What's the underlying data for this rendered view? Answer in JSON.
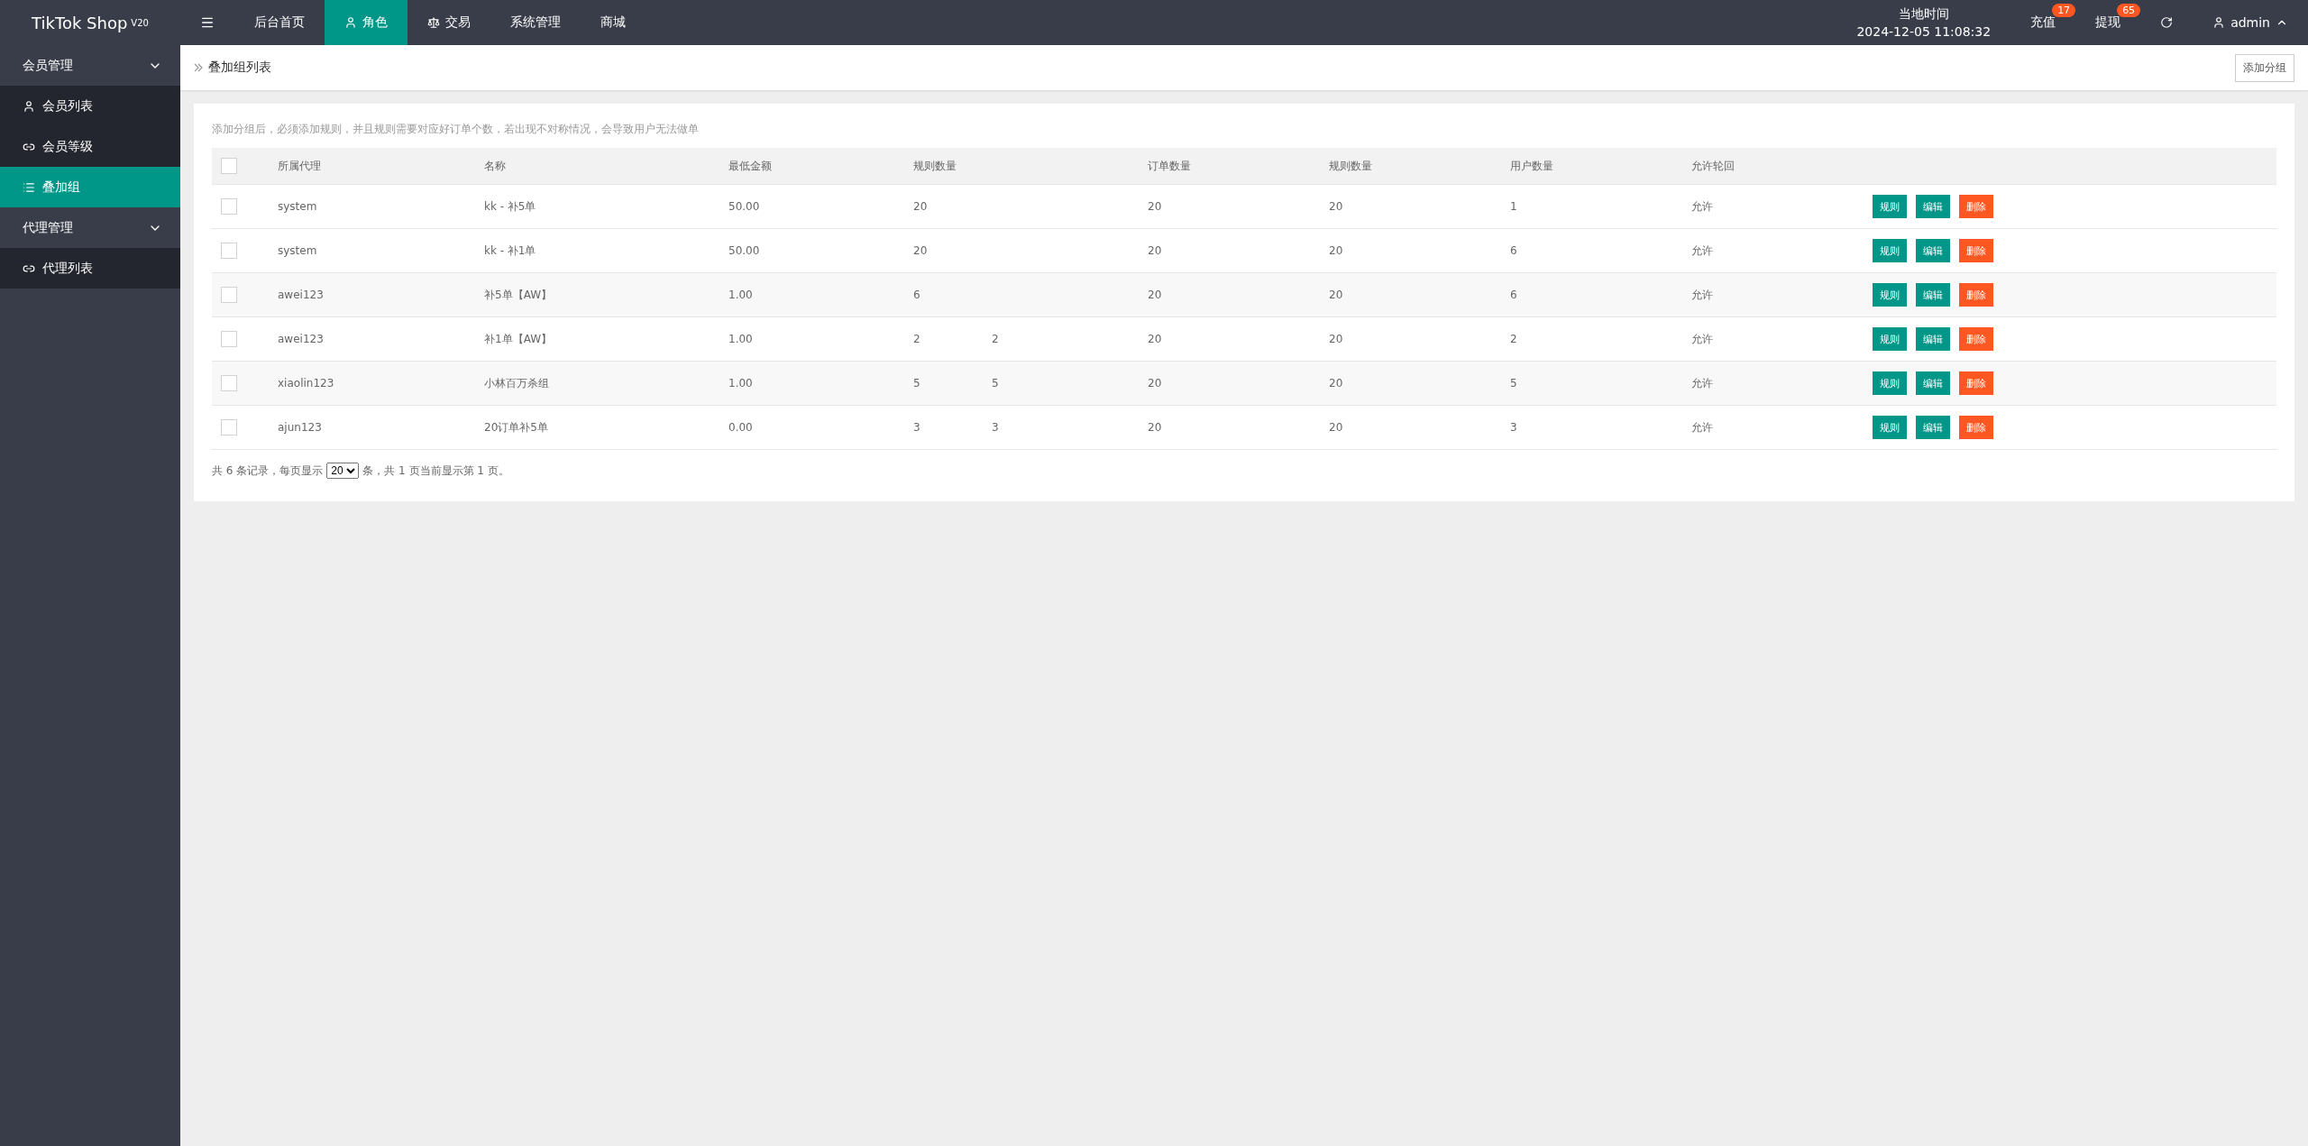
{
  "brand": {
    "name": "TikTok Shop",
    "version": "V20"
  },
  "top_nav": [
    {
      "label": "后台首页",
      "selected": false
    },
    {
      "label": "角色",
      "selected": true
    },
    {
      "label": "交易",
      "selected": false
    },
    {
      "label": "系统管理",
      "selected": false
    },
    {
      "label": "商城",
      "selected": false
    }
  ],
  "clock": {
    "label": "当地时间",
    "value": "2024-12-05 11:08:32"
  },
  "top_actions": [
    {
      "label": "充值",
      "badge": "17"
    },
    {
      "label": "提现",
      "badge": "65"
    }
  ],
  "user": {
    "name": "admin"
  },
  "sidebar": [
    {
      "label": "会员管理",
      "expanded": true,
      "children": [
        {
          "label": "会员列表",
          "selected": false
        },
        {
          "label": "会员等级",
          "selected": false
        },
        {
          "label": "叠加组",
          "selected": true
        }
      ]
    },
    {
      "label": "代理管理",
      "expanded": true,
      "children": [
        {
          "label": "代理列表",
          "selected": false
        }
      ]
    }
  ],
  "breadcrumb": "叠加组列表",
  "add_button": "添加分组",
  "notice": "添加分组后，必须添加规则，并且规则需要对应好订单个数，若出现不对称情况，会导致用户无法做单",
  "table": {
    "header_checked": false,
    "columns": [
      "所属代理",
      "名称",
      "最低金额",
      "规则数量",
      "",
      "订单数量",
      "规则数量",
      "用户数量",
      "允许轮回",
      ""
    ],
    "rows": [
      {
        "checked": false,
        "cells": [
          "system",
          "kk - 补5单",
          "50.00",
          "20",
          "",
          "20",
          "20",
          "1",
          "允许"
        ],
        "actions": [
          "规则",
          "编辑",
          "删除"
        ]
      },
      {
        "checked": false,
        "cells": [
          "system",
          "kk - 补1单",
          "50.00",
          "20",
          "",
          "20",
          "20",
          "6",
          "允许"
        ],
        "actions": [
          "规则",
          "编辑",
          "删除"
        ]
      },
      {
        "checked": false,
        "cells": [
          "awei123",
          "补5单【AW】",
          "1.00",
          "6",
          "",
          "20",
          "20",
          "6",
          "允许"
        ],
        "actions": [
          "规则",
          "编辑",
          "删除"
        ]
      },
      {
        "checked": false,
        "cells": [
          "awei123",
          "补1单【AW】",
          "1.00",
          "2",
          "2",
          "20",
          "20",
          "2",
          "允许"
        ],
        "actions": [
          "规则",
          "编辑",
          "删除"
        ]
      },
      {
        "checked": false,
        "cells": [
          "xiaolin123",
          "小林百万杀组",
          "1.00",
          "5",
          "5",
          "20",
          "20",
          "5",
          "允许"
        ],
        "actions": [
          "规则",
          "编辑",
          "删除"
        ]
      },
      {
        "checked": false,
        "cells": [
          "ajun123",
          "20订单补5单",
          "0.00",
          "3",
          "3",
          "20",
          "20",
          "3",
          "允许"
        ],
        "actions": [
          "规则",
          "编辑",
          "删除"
        ]
      }
    ]
  },
  "pager": {
    "before": "共 6 条记录，每页显示",
    "page_size": "20",
    "after": "条，共 1 页当前显示第 1 页。"
  }
}
